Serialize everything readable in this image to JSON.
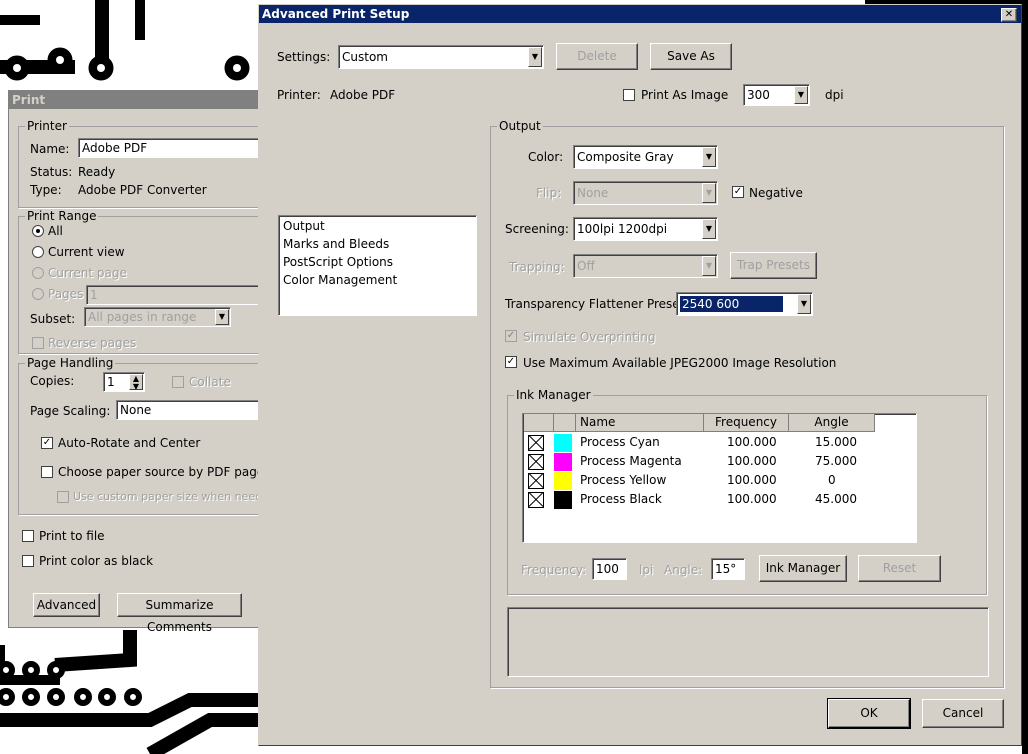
{
  "print_dialog": {
    "title": "Print",
    "printer_group": "Printer",
    "name_label": "Name:",
    "name_value": "Adobe PDF",
    "status_label": "Status:",
    "status_value": "Ready",
    "type_label": "Type:",
    "type_value": "Adobe PDF Converter",
    "print_range_group": "Print Range",
    "range_all": "All",
    "range_current_view": "Current view",
    "range_current_page": "Current page",
    "range_pages": "Pages",
    "pages_value": "1",
    "subset_label": "Subset:",
    "subset_value": "All pages in range",
    "reverse_pages": "Reverse pages",
    "page_handling_group": "Page Handling",
    "copies_label": "Copies:",
    "copies_value": "1",
    "collate": "Collate",
    "page_scaling_label": "Page Scaling:",
    "page_scaling_value": "None",
    "auto_rotate": "Auto-Rotate and Center",
    "choose_paper": "Choose paper source by PDF page size",
    "custom_paper": "Use custom paper size when needed",
    "print_to_file": "Print to file",
    "print_color_black": "Print color as black",
    "advanced_button": "Advanced",
    "summarize_button": "Summarize Comments"
  },
  "advanced_dialog": {
    "title": "Advanced Print Setup",
    "close_glyph": "✕",
    "settings_label": "Settings:",
    "settings_value": "Custom",
    "delete_button": "Delete",
    "save_as_button": "Save As",
    "printer_label": "Printer:",
    "printer_value": "Adobe PDF",
    "print_as_image": "Print As Image",
    "dpi_value": "300",
    "dpi_unit": "dpi",
    "nav_items": [
      "Output",
      "Marks and Bleeds",
      "PostScript Options",
      "Color Management"
    ],
    "output_group": "Output",
    "color_label": "Color:",
    "color_value": "Composite Gray",
    "flip_label": "Flip:",
    "flip_value": "None",
    "negative": "Negative",
    "screening_label": "Screening:",
    "screening_value": "100lpi 1200dpi",
    "trapping_label": "Trapping:",
    "trapping_value": "Off",
    "trap_presets_button": "Trap Presets",
    "flattener_label": "Transparency Flattener Preset:",
    "flattener_value": "2540 600",
    "simulate_overprinting": "Simulate Overprinting",
    "use_max_jpeg": "Use Maximum Available JPEG2000 Image Resolution",
    "ink_manager_group": "Ink Manager",
    "ink_columns": [
      "Name",
      "Frequency",
      "Angle"
    ],
    "inks": [
      {
        "name": "Process Cyan",
        "frequency": "100.000",
        "angle": "15.000",
        "color": "#00ffff"
      },
      {
        "name": "Process Magenta",
        "frequency": "100.000",
        "angle": "75.000",
        "color": "#ff00ff"
      },
      {
        "name": "Process Yellow",
        "frequency": "100.000",
        "angle": "0",
        "color": "#ffff00"
      },
      {
        "name": "Process Black",
        "frequency": "100.000",
        "angle": "45.000",
        "color": "#000000"
      }
    ],
    "frequency_label": "Frequency:",
    "frequency_value": "100",
    "lpi_unit": "lpi",
    "angle_label": "Angle:",
    "angle_value": "15°",
    "ink_manager_button": "Ink Manager",
    "reset_button": "Reset",
    "ok_button": "OK",
    "cancel_button": "Cancel"
  },
  "colors": {
    "title_active": "#0a246a",
    "title_inactive": "#808080",
    "dialog_face": "#d4d0c8",
    "selection": "#0a246a"
  }
}
